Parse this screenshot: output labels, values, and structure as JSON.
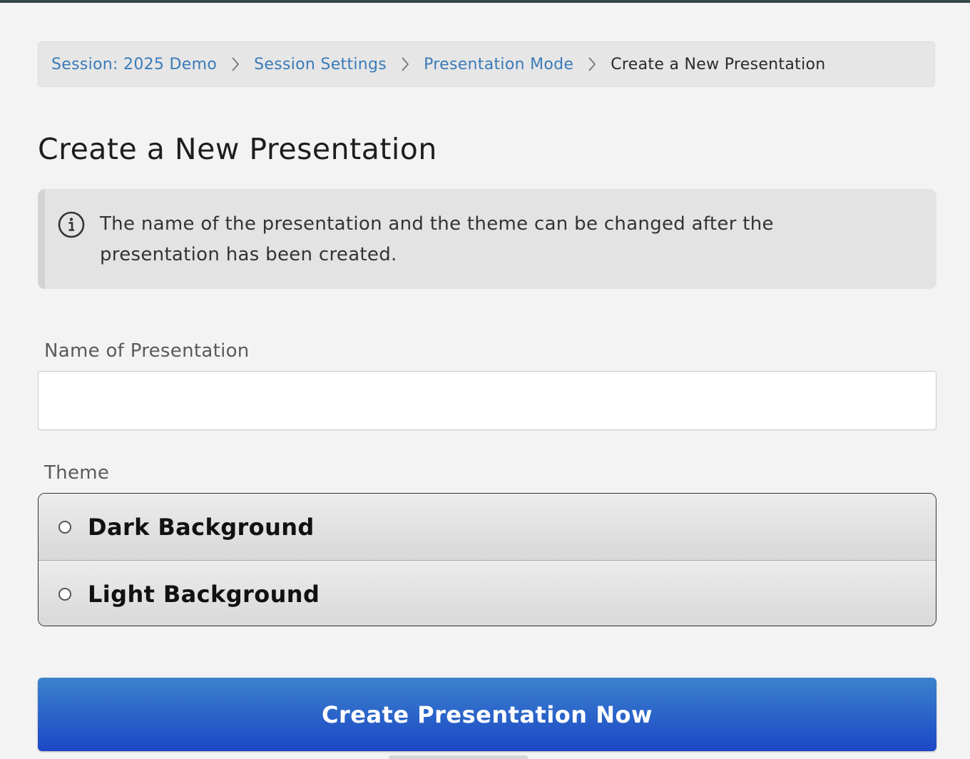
{
  "breadcrumb": {
    "items": [
      {
        "label": "Session: 2025 Demo"
      },
      {
        "label": "Session Settings"
      },
      {
        "label": "Presentation Mode"
      },
      {
        "label": "Create a New Presentation"
      }
    ]
  },
  "page": {
    "title": "Create a New Presentation"
  },
  "info": {
    "icon": "info-circle-icon",
    "text": "The name of the presentation and the theme can be changed after the presentation has been created."
  },
  "form": {
    "name_label": "Name of Presentation",
    "name_value": "",
    "theme_label": "Theme",
    "theme_options": [
      {
        "label": "Dark Background",
        "selected": false
      },
      {
        "label": "Light Background",
        "selected": false
      }
    ],
    "submit_label": "Create Presentation Now"
  },
  "colors": {
    "link": "#3a7bb8",
    "button_top": "#3b82cc",
    "button_bottom": "#1c47c6",
    "top_strip": "#34474a"
  }
}
